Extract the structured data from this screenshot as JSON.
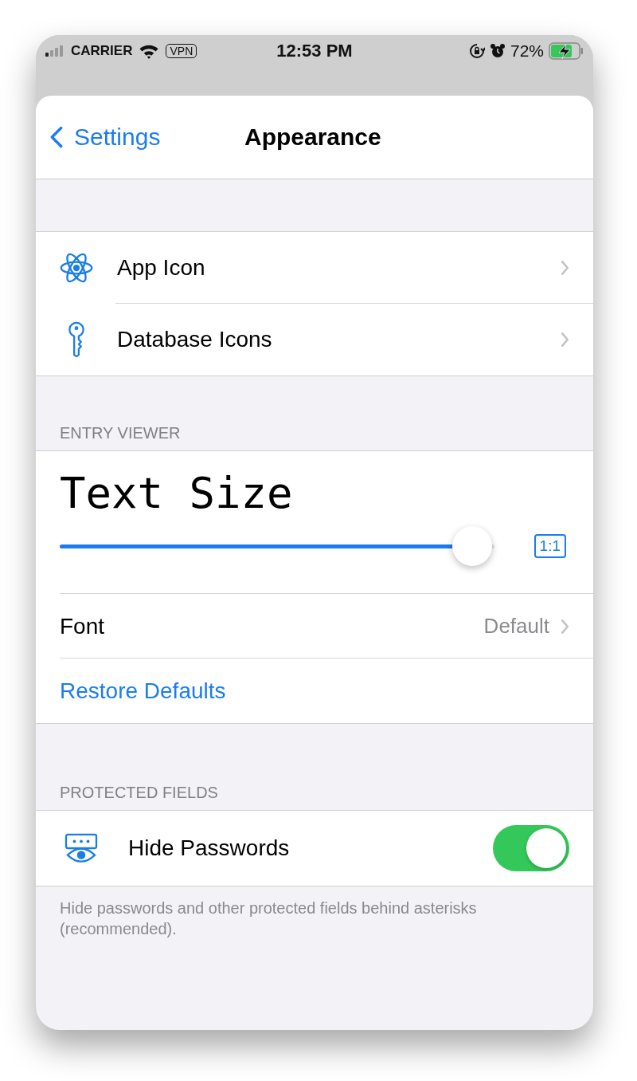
{
  "status_bar": {
    "carrier": "CARRIER",
    "vpn": "VPN",
    "time": "12:53 PM",
    "battery": "72%",
    "charging": true
  },
  "nav": {
    "back": "Settings",
    "title": "Appearance"
  },
  "links_group": [
    {
      "kind": "atom",
      "label": "App Icon"
    },
    {
      "kind": "key",
      "label": "Database Icons"
    }
  ],
  "entry_viewer": {
    "header": "ENTRY VIEWER",
    "preview": "Text Size",
    "slider": {
      "level": 0.95
    },
    "scale_badge": "1:1",
    "font": {
      "label": "Font",
      "value": "Default"
    },
    "restore": "Restore Defaults"
  },
  "protected_fields": {
    "header": "PROTECTED FIELDS",
    "toggle": {
      "label": "Hide Passwords",
      "on": true
    },
    "footnote": "Hide passwords and other protected fields behind asterisks (recommended)."
  }
}
